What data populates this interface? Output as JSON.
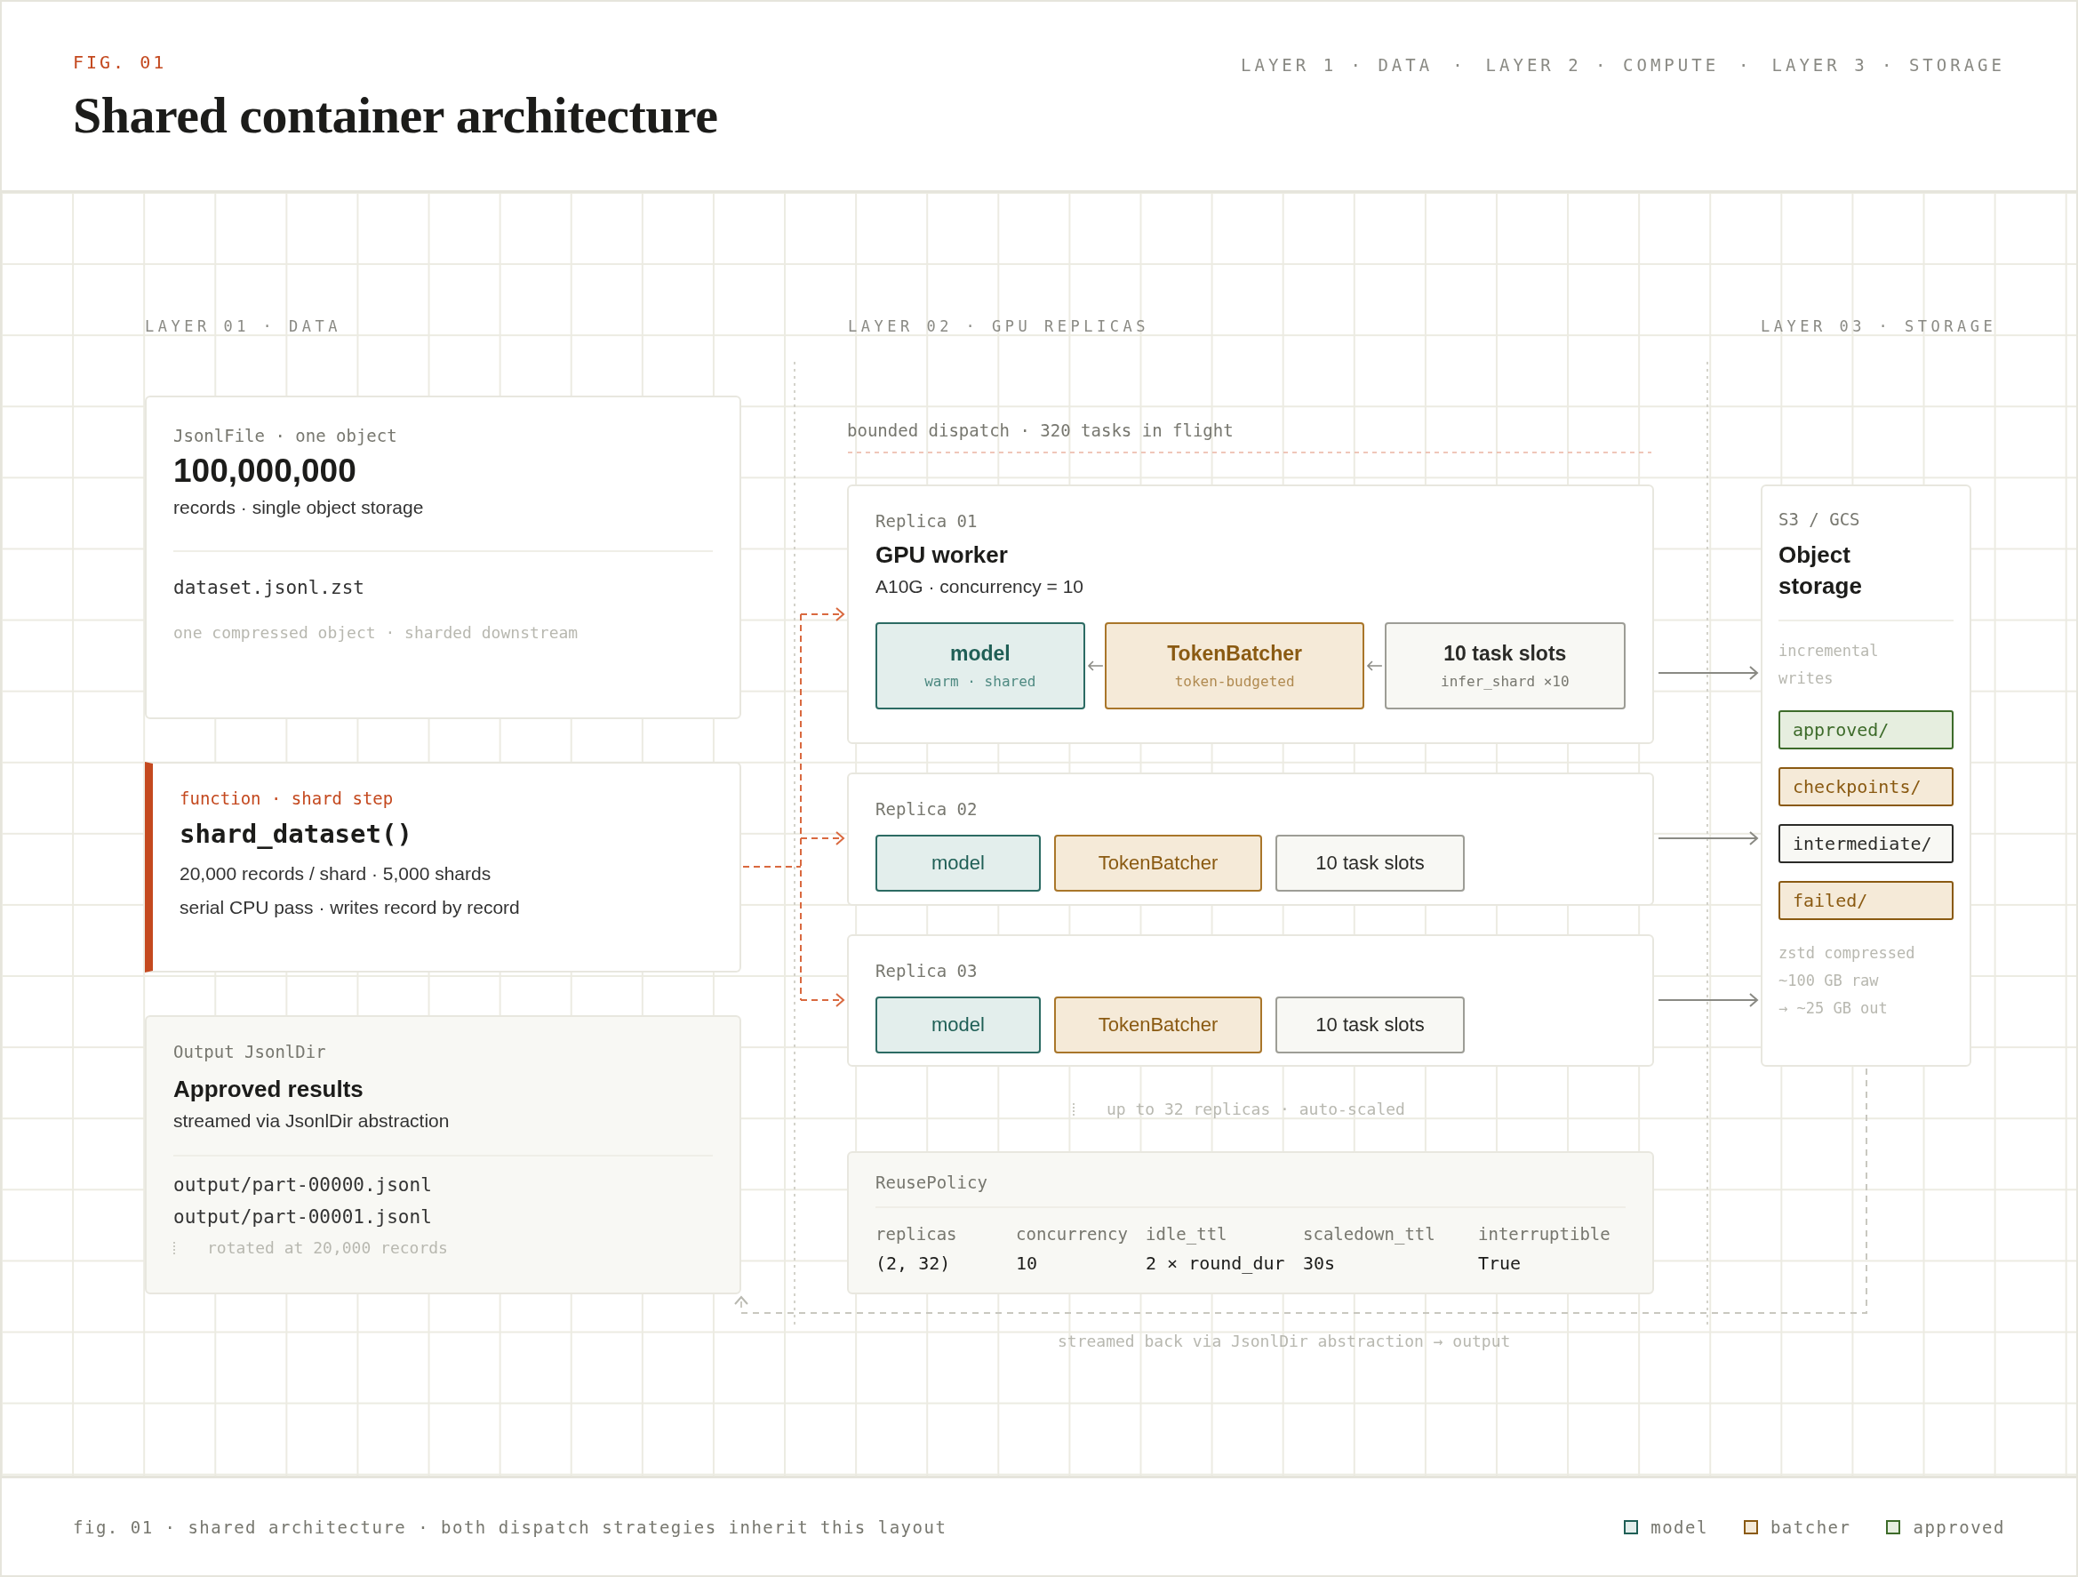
{
  "header": {
    "fig_label": "FIG. 01",
    "title": "Shared container architecture",
    "separator": "·",
    "layers": [
      "LAYER 1 · DATA",
      "LAYER 2 · COMPUTE",
      "LAYER 3 · STORAGE"
    ]
  },
  "layer_labels": [
    "LAYER 01 · DATA",
    "LAYER 02 · GPU REPLICAS",
    "LAYER 03 · STORAGE"
  ],
  "source_card": {
    "caption": "JsonlFile · one object",
    "value": "100,000,000",
    "subtitle": "records · single object storage",
    "filename": "dataset.jsonl.zst",
    "note": "one compressed object · sharded downstream"
  },
  "shard_card": {
    "caption": "function · shard step",
    "title": "shard_dataset()",
    "lines": [
      "20,000 records / shard · 5,000 shards",
      "serial CPU pass · writes record by record"
    ]
  },
  "output_card": {
    "caption": "Output JsonlDir",
    "title": "Approved results",
    "subtitle": "streamed via JsonlDir abstraction",
    "files": [
      "output/part-00000.jsonl",
      "output/part-00001.jsonl"
    ],
    "note": "rotated at 20,000 records"
  },
  "dispatch_label": "bounded dispatch · 320 tasks in flight",
  "replicas": [
    {
      "label": "Replica 01",
      "title": "GPU worker",
      "subtitle": "A10G · concurrency = 10",
      "flow_arrows": true,
      "components": [
        {
          "kind": "model",
          "name": "model",
          "detail": "warm · shared"
        },
        {
          "kind": "batcher",
          "name": "TokenBatcher",
          "detail": "token-budgeted"
        },
        {
          "kind": "slots",
          "name": "10 task slots",
          "detail": "infer_shard ×10"
        }
      ]
    },
    {
      "label": "Replica 02",
      "flow_arrows": false,
      "components": [
        {
          "kind": "model",
          "name": "model"
        },
        {
          "kind": "batcher",
          "name": "TokenBatcher"
        },
        {
          "kind": "slots",
          "name": "10 task slots"
        }
      ]
    },
    {
      "label": "Replica 03",
      "flow_arrows": false,
      "components": [
        {
          "kind": "model",
          "name": "model"
        },
        {
          "kind": "batcher",
          "name": "TokenBatcher"
        },
        {
          "kind": "slots",
          "name": "10 task slots"
        }
      ]
    }
  ],
  "scaling_note": "up to 32 replicas · auto-scaled",
  "reuse_policy": {
    "title": "ReusePolicy",
    "fields": [
      {
        "key": "replicas",
        "value": "(2, 32)"
      },
      {
        "key": "concurrency",
        "value": "10"
      },
      {
        "key": "idle_ttl",
        "value": "2 × round_dur"
      },
      {
        "key": "scaledown_ttl",
        "value": "30s"
      },
      {
        "key": "interruptible",
        "value": "True"
      }
    ]
  },
  "storage": {
    "caption": "S3 / GCS",
    "title": "Object storage",
    "note": "incremental writes",
    "prefixes": [
      {
        "kind": "approved",
        "name": "approved/"
      },
      {
        "kind": "batcher",
        "name": "checkpoints/"
      },
      {
        "kind": "slots",
        "name": "intermediate/"
      },
      {
        "kind": "batcher",
        "name": "failed/"
      }
    ],
    "footnote": [
      "zstd compressed",
      "~100 GB raw",
      "→ ~25 GB out"
    ]
  },
  "return_label": "streamed back via JsonlDir abstraction → output",
  "footer": {
    "caption": "fig. 01 · shared architecture · both dispatch strategies inherit this layout",
    "legend": [
      {
        "kind": "model",
        "label": "model"
      },
      {
        "kind": "batcher",
        "label": "batcher"
      },
      {
        "kind": "approved",
        "label": "approved"
      }
    ]
  }
}
